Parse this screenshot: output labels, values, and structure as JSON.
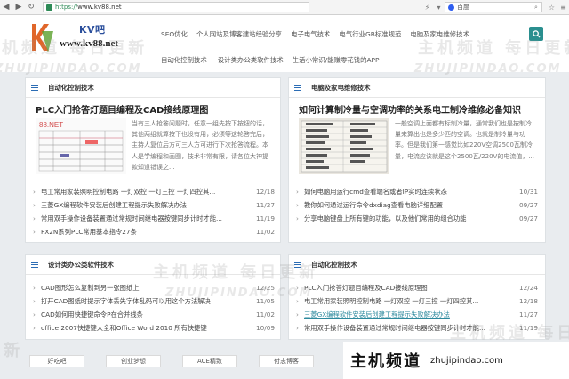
{
  "browser": {
    "url_prefix": "https://",
    "url_host": "www.kv88.net",
    "search_placeholder": "百度"
  },
  "site": {
    "logo_kv": "KV吧",
    "logo_url": "www.kv88.net",
    "nav": [
      "SEO优化",
      "个人网站及博客建站经验分享",
      "电子电气技术",
      "电气行业GB标准规范",
      "电脑及家电维修技术",
      "自动化控制技术",
      "设计类办公类软件技术",
      "生活小常识/能赚零花钱的APP"
    ]
  },
  "panels": {
    "automation": {
      "title": "自动化控制技术",
      "featured_title": "PLC入门抢答灯题目编程及CAD接线原理图",
      "summary": "当有三人抢答问题时，任意一组先按下按钮的话，其他两组就算按下也没有用，必须等这轮答完后，主持人复位后方可三人方可进行下次抢答流程。本人是学编程和画图，技术非常有限，请各位大神提款知道错误之...",
      "items": [
        {
          "title": "电工常用家装照明控制电路 一灯双控 一灯三控 一灯四控其...",
          "date": "12/18"
        },
        {
          "title": "三菱GX编程软件安装后创建工程提示失败解决办法",
          "date": "11/27"
        },
        {
          "title": "常用双手操作设备装置通过常规时间继电器按键同步计时才能...",
          "date": "11/19"
        },
        {
          "title": "FX2N系列PLC常用基本指令27条",
          "date": "11/02"
        }
      ]
    },
    "repair": {
      "title": "电脑及家电维修技术",
      "featured_title": "如何计算制冷量与空调功率的关系电工制冷维修必备知识",
      "summary": "一般空调上面都有标制冷量，通常我们也是按制冷量来算出也是多少匹的空调。也就是制冷量与功率。但是我们第一感觉比如220V空调2500瓦制冷量，电流应该就是这个2500瓦/220V的电流值，...",
      "items": [
        {
          "title": "如何电脑用运行cmd查看端名或者IP实时连续状态",
          "date": "10/31"
        },
        {
          "title": "教你如何通过运行命令dxdiag查看电脑详细配置",
          "date": "09/27"
        },
        {
          "title": "分享电脑键盘上所有键的功能，以及他们常用的组合功能",
          "date": "09/27"
        }
      ]
    },
    "design": {
      "title": "设计类办公类软件技术",
      "items": [
        {
          "title": "CAD图形怎么复制到另一张图纸上",
          "date": "12/25"
        },
        {
          "title": "打开CAD图纸时提示字体丢失字体乱码可以用这个方法解决",
          "date": "11/05"
        },
        {
          "title": "CAD如何用快捷键命令P在合并线条",
          "date": "11/02"
        },
        {
          "title": "office 2007快捷键大全和Office Word 2010 所有快捷键",
          "date": "10/09"
        }
      ]
    },
    "automation2": {
      "title": "自动化控制技术",
      "items": [
        {
          "title": "PLC入门抢答灯题目编程及CAD接线原理图",
          "date": "12/24"
        },
        {
          "title": "电工常用家装照明控制电路 一灯双控 一灯三控 一灯四控其...",
          "date": "12/18"
        },
        {
          "title": "三菱GX编程软件安装后创建工程提示失败解决办法",
          "date": "11/27"
        },
        {
          "title": "常用双手操作设备装置通过常规时间继电器按键同步计时才能...",
          "date": "11/19"
        }
      ]
    }
  },
  "footer_links": [
    "好吃吧",
    "创业梦想",
    "ACE精致",
    "付志博客"
  ],
  "watermark": {
    "cn": "主机频道  每日更新",
    "en": "ZHUJIPINDAO.COM",
    "brand_cn": "主机频道",
    "brand_domain": "zhujipindao.com"
  },
  "colors": {
    "accent": "#2a8f8f",
    "icon_blue": "#2c6db5",
    "highlight_link": "#2d8a9e"
  }
}
